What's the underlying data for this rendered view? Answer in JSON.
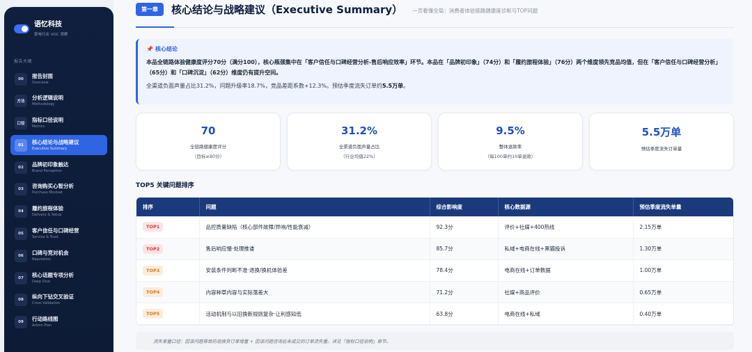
{
  "sidebar": {
    "brand_title": "语忆科技",
    "brand_subtitle": "家电行业 VOC 洞察",
    "section_label": "报告大纲",
    "items": [
      {
        "badge": "00",
        "label": "报告封面",
        "sub": "Overview"
      },
      {
        "badge": "方法",
        "label": "分析逻辑说明",
        "sub": "Methodology"
      },
      {
        "badge": "口径",
        "label": "指标口径说明",
        "sub": "Metrics"
      },
      {
        "badge": "01",
        "label": "核心结论与战略建议",
        "sub": "Executive Summary"
      },
      {
        "badge": "02",
        "label": "品牌初印象触达",
        "sub": "Brand Perception"
      },
      {
        "badge": "03",
        "label": "咨询购买心智分析",
        "sub": "Purchase Mindset"
      },
      {
        "badge": "04",
        "label": "履约旅程体验",
        "sub": "Delivery & Setup"
      },
      {
        "badge": "05",
        "label": "客户信任与口碑经营",
        "sub": "Service & Trust"
      },
      {
        "badge": "06",
        "label": "口碑与竞对机会",
        "sub": "Reputation"
      },
      {
        "badge": "07",
        "label": "核心话题专项分析",
        "sub": "Deep Dive"
      },
      {
        "badge": "08",
        "label": "纵向下钻交叉验证",
        "sub": "Cross Validation"
      },
      {
        "badge": "09",
        "label": "行动路线图",
        "sub": "Action Plan"
      }
    ],
    "active_index": 3
  },
  "header": {
    "chapter": "第一章",
    "title": "核心结论与战略建议（Executive Summary）",
    "subtitle": "一页看懂全局：消费者体验链路健康度诊断与TOP问题"
  },
  "conclusion": {
    "title": "核心结论",
    "p1": "本品全链路体验健康度评分70分（满分100），核心瓶颈集中在「客户信任与口碑经营分析-售后响应效率」环节。本品在「品牌初印象」（74分）和「履约旅程体验」（76分）两个维度领先竞品均值，但在「客户信任与口碑经营分析」（65分）和「口碑沉淀」（62分）维度仍有提升空间。",
    "p2_text": "全渠道负面声量占比31.2%，问题升级率18.7%，竞品差距系数+12.3%。预估季度流失订单约",
    "p2_bold": "5.5万单",
    "p2_end": "。"
  },
  "kpis": [
    {
      "value": "70",
      "label": "全链路健康度评分",
      "note": "（目标≥80分）"
    },
    {
      "value": "31.2%",
      "label": "全渠道负面声量占比",
      "note": "（行业均值22%）"
    },
    {
      "value": "9.5%",
      "label": "整体退款率",
      "note": "（每100单约10单退款）"
    },
    {
      "value": "5.5万单",
      "label": "预估季度流失订单量",
      "note": ""
    }
  ],
  "top5": {
    "title": "TOP5 关键问题排序",
    "columns": [
      "排序",
      "问题",
      "综合影响度",
      "核心数据源",
      "预估季度流失单量"
    ],
    "rows": [
      {
        "rank": "TOP1",
        "issue": "品控质量缺陷（核心部件故障/异响/性能衰减）",
        "impact": "92.3分",
        "source": "评价+社媒+400热线",
        "loss": "2.15万单",
        "tone": "red"
      },
      {
        "rank": "TOP2",
        "issue": "售后响应慢·处理推诿",
        "impact": "85.7分",
        "source": "私域+电商在线+黑猫投诉",
        "loss": "1.30万单",
        "tone": "red"
      },
      {
        "rank": "TOP3",
        "issue": "安装条件判断不准·退换/换机体验差",
        "impact": "78.4分",
        "source": "电商在线+订单数据",
        "loss": "1.00万单",
        "tone": "orange"
      },
      {
        "rank": "TOP4",
        "issue": "内容种草内容与实际落差大",
        "impact": "71.2分",
        "source": "社媒+商品评价",
        "loss": "0.65万单",
        "tone": "orange"
      },
      {
        "rank": "TOP5",
        "issue": "活动机制与以旧换新规则复杂·让利感知低",
        "impact": "63.8分",
        "source": "电商在线+私域",
        "loss": "0.40万单",
        "tone": "orange"
      }
    ]
  },
  "footnote": "流失单量口径：因该问题导致的退换货订单增量 + 因该问题咨询后未成交的订单流失量。详见「指标口径说明」章节。",
  "colors": {
    "accent": "#2f64e3",
    "sidebar_bg": "#0f1f3d",
    "table_header": "#1a3a7c",
    "top_red": "#d93a3a",
    "top_orange": "#d9771f"
  }
}
